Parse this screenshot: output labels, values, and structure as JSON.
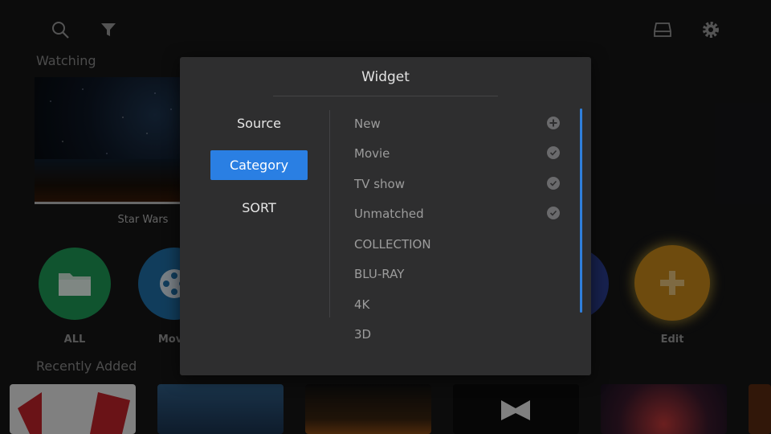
{
  "toolbar": {
    "left_icons": [
      "search-icon",
      "filter-icon"
    ],
    "right_icons": [
      "storage-icon",
      "gear-icon"
    ]
  },
  "watching": {
    "section_title": "Watching",
    "item_title": "Star Wars",
    "progress": 0.95
  },
  "categories": [
    {
      "label": "ALL",
      "color": "#1e9a57",
      "icon": "folder-icon"
    },
    {
      "label": "Mov",
      "color": "#1f6fa8",
      "icon": "film-reel-icon"
    },
    {
      "label": "Edit",
      "color": "#c9891a",
      "icon": "plus-icon"
    }
  ],
  "recently_added": {
    "section_title": "Recently Added"
  },
  "dialog": {
    "title": "Widget",
    "left_menu": [
      {
        "label": "Source",
        "active": false
      },
      {
        "label": "Category",
        "active": true
      },
      {
        "label": "SORT",
        "active": false
      }
    ],
    "items": [
      {
        "label": "New",
        "icon": "plus-icon"
      },
      {
        "label": "Movie",
        "icon": "check-icon"
      },
      {
        "label": "TV show",
        "icon": "check-icon"
      },
      {
        "label": "Unmatched",
        "icon": "check-icon"
      },
      {
        "label": "COLLECTION",
        "icon": ""
      },
      {
        "label": "BLU-RAY",
        "icon": ""
      },
      {
        "label": "4K",
        "icon": ""
      },
      {
        "label": "3D",
        "icon": ""
      }
    ]
  },
  "colors": {
    "accent": "#2a7fe3",
    "dialog_bg": "#2e2e2f",
    "screen_bg": "#161617"
  }
}
